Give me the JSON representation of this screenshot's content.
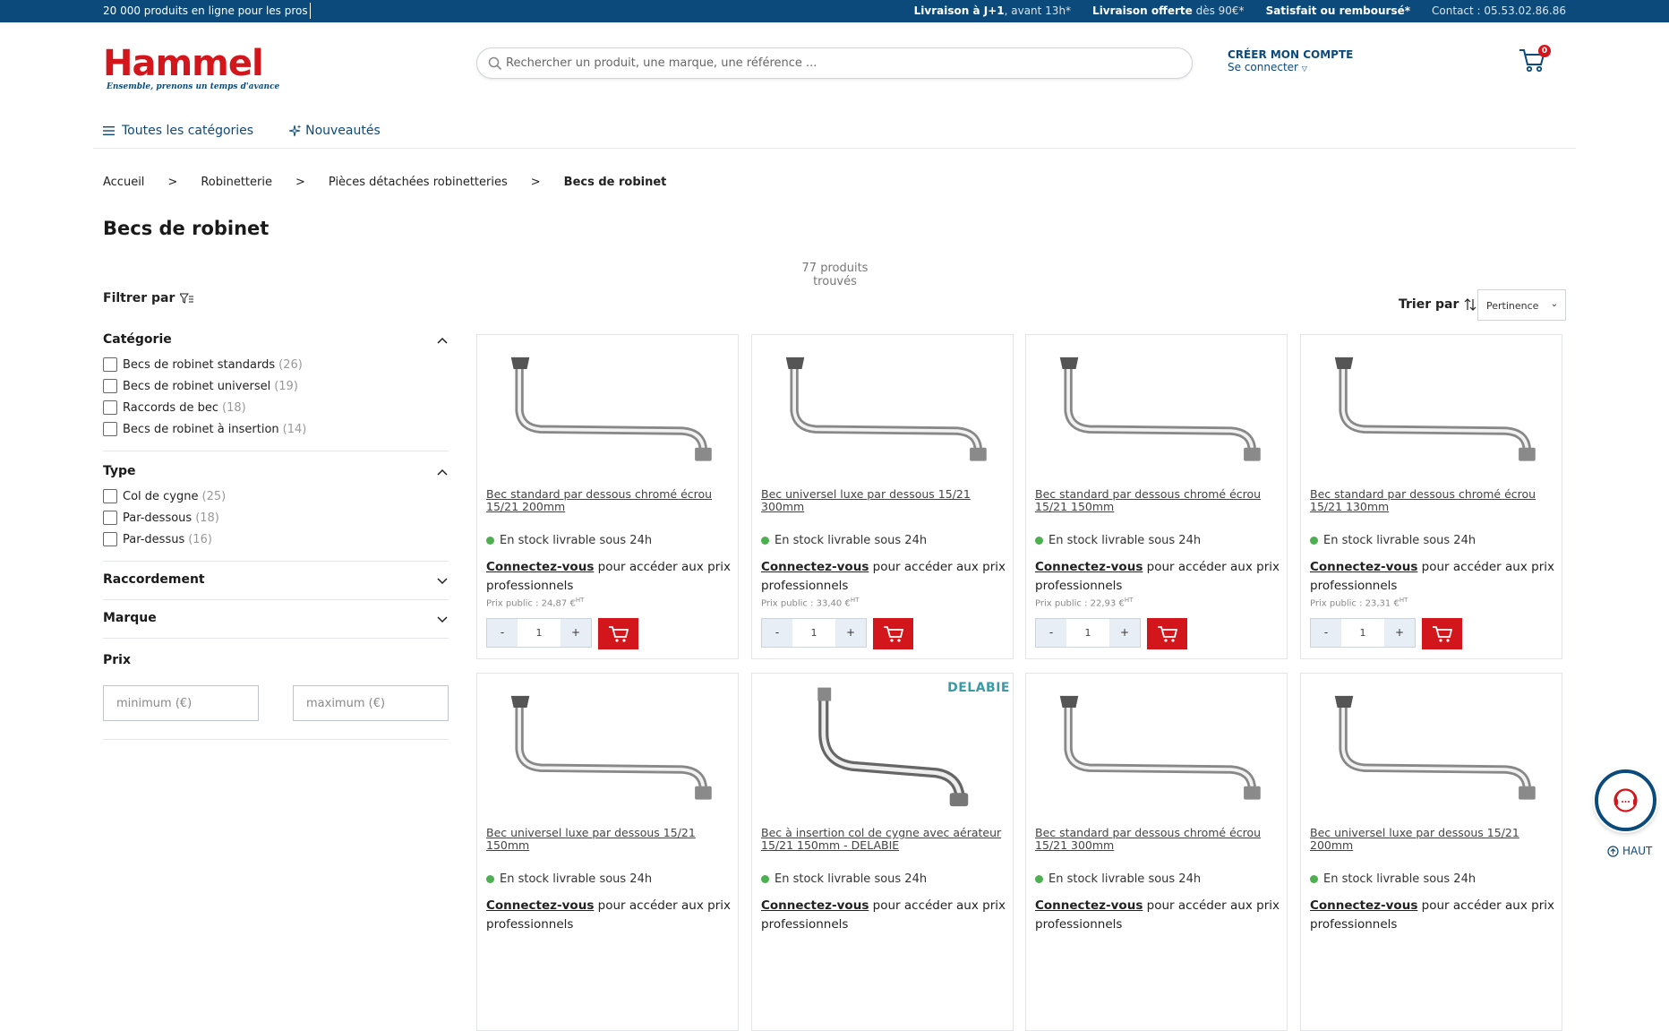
{
  "topbar": {
    "left": "20 000 produits en ligne pour les pros",
    "delivery_bold": "Livraison à J+1",
    "delivery_thin": ", avant 13h*",
    "free_bold": "Livraison offerte",
    "free_thin": " dès 90€*",
    "satisfied": "Satisfait ou remboursé*",
    "contact": "Contact : 05.53.02.86.86"
  },
  "logo": {
    "name": "Hammel",
    "tagline": "Ensemble, prenons un temps d'avance"
  },
  "search": {
    "placeholder": "Rechercher un produit, une marque, une référence ..."
  },
  "account": {
    "create": "CRÉER MON COMPTE",
    "login": "Se connecter"
  },
  "cart": {
    "count": "0"
  },
  "nav": {
    "categories": "Toutes les catégories",
    "new": "Nouveautés"
  },
  "breadcrumb": [
    "Accueil",
    "Robinetterie",
    "Pièces détachées robinetteries",
    "Becs de robinet"
  ],
  "breadcrumb_sep": ">",
  "page": {
    "title": "Becs de robinet",
    "count": "77 produits trouvés"
  },
  "filter": {
    "label": "Filtrer par"
  },
  "sort": {
    "label": "Trier par",
    "selected": "Pertinence"
  },
  "facets": {
    "category": {
      "label": "Catégorie",
      "options": [
        {
          "label": "Becs de robinet standards",
          "count": "(26)"
        },
        {
          "label": "Becs de robinet universel",
          "count": "(19)"
        },
        {
          "label": "Raccords de bec",
          "count": "(18)"
        },
        {
          "label": "Becs de robinet à insertion",
          "count": "(14)"
        }
      ]
    },
    "type": {
      "label": "Type",
      "options": [
        {
          "label": "Col de cygne",
          "count": "(25)"
        },
        {
          "label": "Par-dessous",
          "count": "(18)"
        },
        {
          "label": "Par-dessus",
          "count": "(16)"
        }
      ]
    },
    "connection": {
      "label": "Raccordement"
    },
    "brand": {
      "label": "Marque"
    },
    "price": {
      "label": "Prix",
      "min_placeholder": "minimum (€)",
      "max_placeholder": "maximum (€)"
    }
  },
  "product_common": {
    "stock": "En stock livrable sous 24h",
    "login_link": "Connectez-vous",
    "login_rest": " pour accéder aux prix professionnels",
    "public_prefix": "Prix public : ",
    "ht": "HT",
    "minus": "-",
    "plus": "+",
    "qty": "1"
  },
  "products": [
    {
      "name": "Bec standard par dessous chromé écrou 15/21 200mm",
      "price": "24,87 €"
    },
    {
      "name": "Bec universel luxe par dessous 15/21 300mm",
      "price": "33,40 €"
    },
    {
      "name": "Bec standard par dessous chromé écrou 15/21 150mm",
      "price": "22,93 €"
    },
    {
      "name": "Bec standard par dessous chromé écrou 15/21 130mm",
      "price": "23,31 €"
    },
    {
      "name": "Bec universel luxe par dessous 15/21 150mm"
    },
    {
      "name": "Bec à insertion col de cygne avec aérateur 15/21 150mm - DELABIE",
      "brand": "DELABIE"
    },
    {
      "name": "Bec standard par dessous chromé écrou 15/21 300mm"
    },
    {
      "name": "Bec universel luxe par dessous 15/21 200mm"
    }
  ],
  "help": {
    "up": "HAUT"
  },
  "colors": {
    "primary": "#0b4a7a",
    "accent": "#d3161c",
    "stock": "#4caf50"
  }
}
